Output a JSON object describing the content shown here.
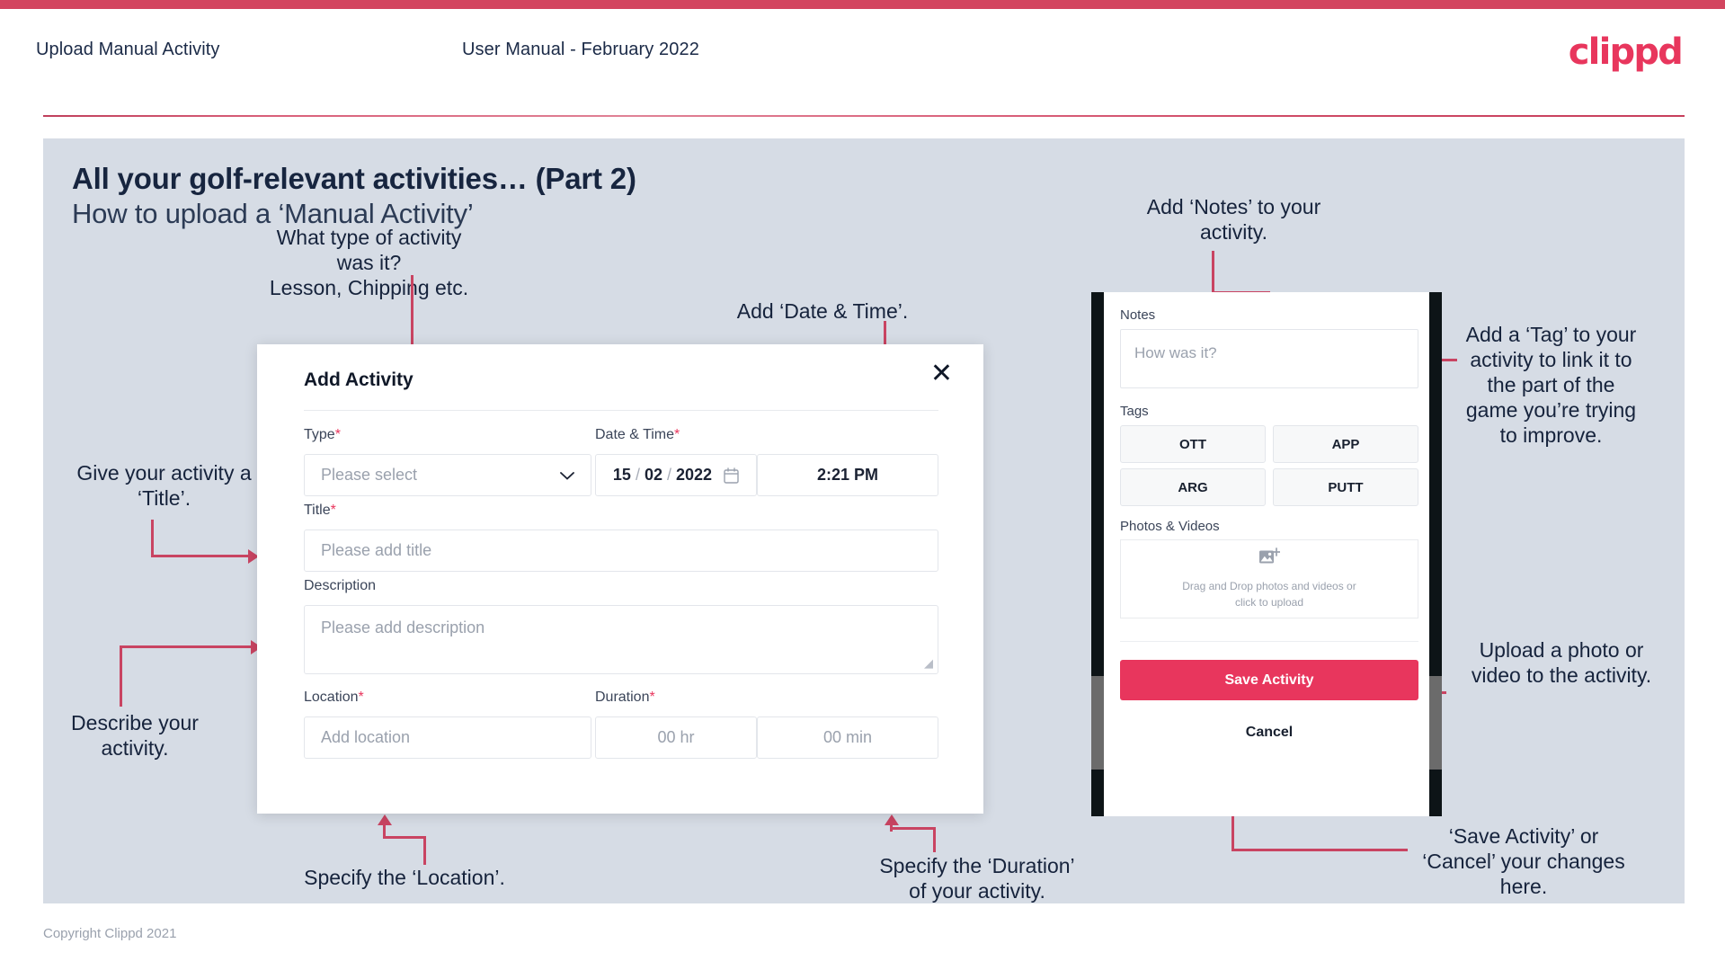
{
  "header": {
    "title": "Upload Manual Activity",
    "subtitle": "User Manual - February 2022",
    "logo": "clippd",
    "accent_color": "#d3455f"
  },
  "slide": {
    "heading": "All your golf-relevant activities… (Part 2)",
    "subheading": "How to upload a ‘Manual Activity’",
    "background_color": "#d6dce5"
  },
  "annotations": {
    "type": "What type of activity was it?\nLesson, Chipping etc.",
    "type_line1": "What type of activity was it?",
    "type_line2": "Lesson, Chipping etc.",
    "datetime": "Add ‘Date & Time’.",
    "title": "Give your activity a\n‘Title’.",
    "title_line1": "Give your activity a",
    "title_line2": "‘Title’.",
    "describe_line1": "Describe your",
    "describe_line2": "activity.",
    "location": "Specify the ‘Location’.",
    "duration_line1": "Specify the ‘Duration’",
    "duration_line2": "of your activity.",
    "notes_line1": "Add ‘Notes’ to your",
    "notes_line2": "activity.",
    "tag_line1": "Add a ‘Tag’ to your",
    "tag_line2": "activity to link it to",
    "tag_line3": "the part of the",
    "tag_line4": "game you’re trying",
    "tag_line5": "to improve.",
    "upload_line1": "Upload a photo or",
    "upload_line2": "video to the activity.",
    "save_line1": "‘Save Activity’ or",
    "save_line2": "‘Cancel’ your changes",
    "save_line3": "here.",
    "connector_color": "#c94462"
  },
  "dialog": {
    "title": "Add Activity",
    "close_icon": "✕",
    "fields": {
      "type_label": "Type",
      "type_placeholder": "Please select",
      "datetime_label": "Date & Time",
      "date_day": "15",
      "date_month": "02",
      "date_year": "2022",
      "date_sep": "/",
      "time_value": "2:21 PM",
      "title_label": "Title",
      "title_placeholder": "Please add title",
      "description_label": "Description",
      "description_placeholder": "Please add description",
      "location_label": "Location",
      "location_placeholder": "Add location",
      "duration_label": "Duration",
      "duration_hours_placeholder": "00 hr",
      "duration_minutes_placeholder": "00 min"
    },
    "required_marker": "*"
  },
  "phone": {
    "notes_label": "Notes",
    "notes_placeholder": "How was it?",
    "tags_label": "Tags",
    "tags": [
      "OTT",
      "APP",
      "ARG",
      "PUTT"
    ],
    "photos_label": "Photos & Videos",
    "dropzone_line1": "Drag and Drop photos and videos or",
    "dropzone_line2": "click to upload",
    "save_button": "Save Activity",
    "cancel_button": "Cancel",
    "save_color": "#e8365d"
  },
  "footer": {
    "copyright": "Copyright Clippd 2021"
  }
}
